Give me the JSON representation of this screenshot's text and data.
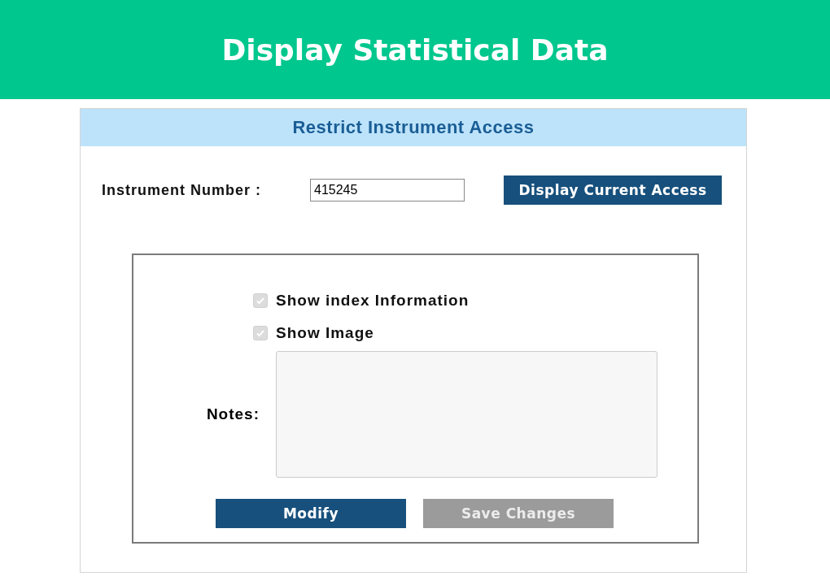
{
  "banner": {
    "title": "Display Statistical Data"
  },
  "panel": {
    "title": "Restrict Instrument Access",
    "instrument_field": {
      "label": "Instrument Number :",
      "value": "415245"
    },
    "display_button": {
      "label": "Display Current Access",
      "disabled": false
    },
    "options": [
      {
        "label": "Show index Information",
        "checked": true,
        "disabled": true
      },
      {
        "label": "Show Image",
        "checked": true,
        "disabled": true
      }
    ],
    "notes": {
      "label": "Notes:",
      "disabled": true
    },
    "buttons": [
      {
        "label": "Modify",
        "disabled": false
      },
      {
        "label": "Save Changes",
        "disabled": true
      }
    ]
  }
}
